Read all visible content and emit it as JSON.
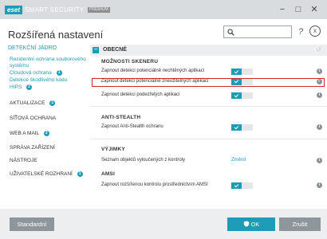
{
  "window": {
    "logo": "eset",
    "product": "SMART SECURITY",
    "edition": "PREMIUM",
    "minimize": "−",
    "maximize": "□",
    "close": "✕"
  },
  "header": {
    "title": "Rozšířená nastavení",
    "search_value": "",
    "help": "?",
    "clear": "x"
  },
  "sidebar": {
    "items": [
      {
        "label": "DETEKČNÍ JÁDRO",
        "active": true
      },
      {
        "label": "Rezidentní ochrana souborového systému",
        "sub": true
      },
      {
        "label": "Cloudová ochrana",
        "sub": true,
        "badge": "1"
      },
      {
        "label": "Detekce škodlivého kódu",
        "sub": true
      },
      {
        "label": "HIPS",
        "sub": true,
        "badge": "2"
      },
      {
        "label": "AKTUALIZACE",
        "badge": "1"
      },
      {
        "label": "SÍŤOVÁ OCHRANA"
      },
      {
        "label": "WEB A MAIL",
        "badge": "2"
      },
      {
        "label": "SPRÁVA ZAŘÍZENÍ"
      },
      {
        "label": "NÁSTROJE"
      },
      {
        "label": "UŽIVATELSKÉ ROZHRANÍ",
        "badge": "1"
      }
    ]
  },
  "content": {
    "section_toggle": "−",
    "section_title": "OBECNÉ",
    "section_reset": "↺",
    "groups": [
      {
        "title": "MOŽNOSTI SKENERU",
        "rows": [
          {
            "label": "Zapnout detekci potenciálně nechtěných aplikací",
            "type": "toggle",
            "on": true
          },
          {
            "label": "Zapnout detekci potenciálně zneužitelných aplikací",
            "type": "toggle",
            "on": true,
            "highlight": true
          },
          {
            "label": "Zapnout detekci podezřelých aplikací",
            "type": "toggle",
            "on": true
          }
        ]
      },
      {
        "title": "ANTI-STEALTH",
        "rows": [
          {
            "label": "Zapnout Anti-Stealth ochranu",
            "type": "toggle",
            "on": true
          }
        ]
      },
      {
        "title": "VÝJIMKY",
        "rows": [
          {
            "label": "Seznam objektů vyloučených z kontroly",
            "type": "link",
            "link": "Změnit"
          }
        ]
      },
      {
        "title": "AMSI",
        "rows": [
          {
            "label": "Zapnout rozšířenou kontrolu prostřednictvím AMSI",
            "type": "toggle",
            "on": true
          }
        ]
      }
    ],
    "info_icon": "i"
  },
  "footer": {
    "default_label": "Standardní",
    "ok_label": "OK",
    "cancel_label": "Zrušit"
  },
  "colors": {
    "accent": "#1e9bb5",
    "highlight": "#d9232e",
    "button_gray": "#8e969b"
  }
}
